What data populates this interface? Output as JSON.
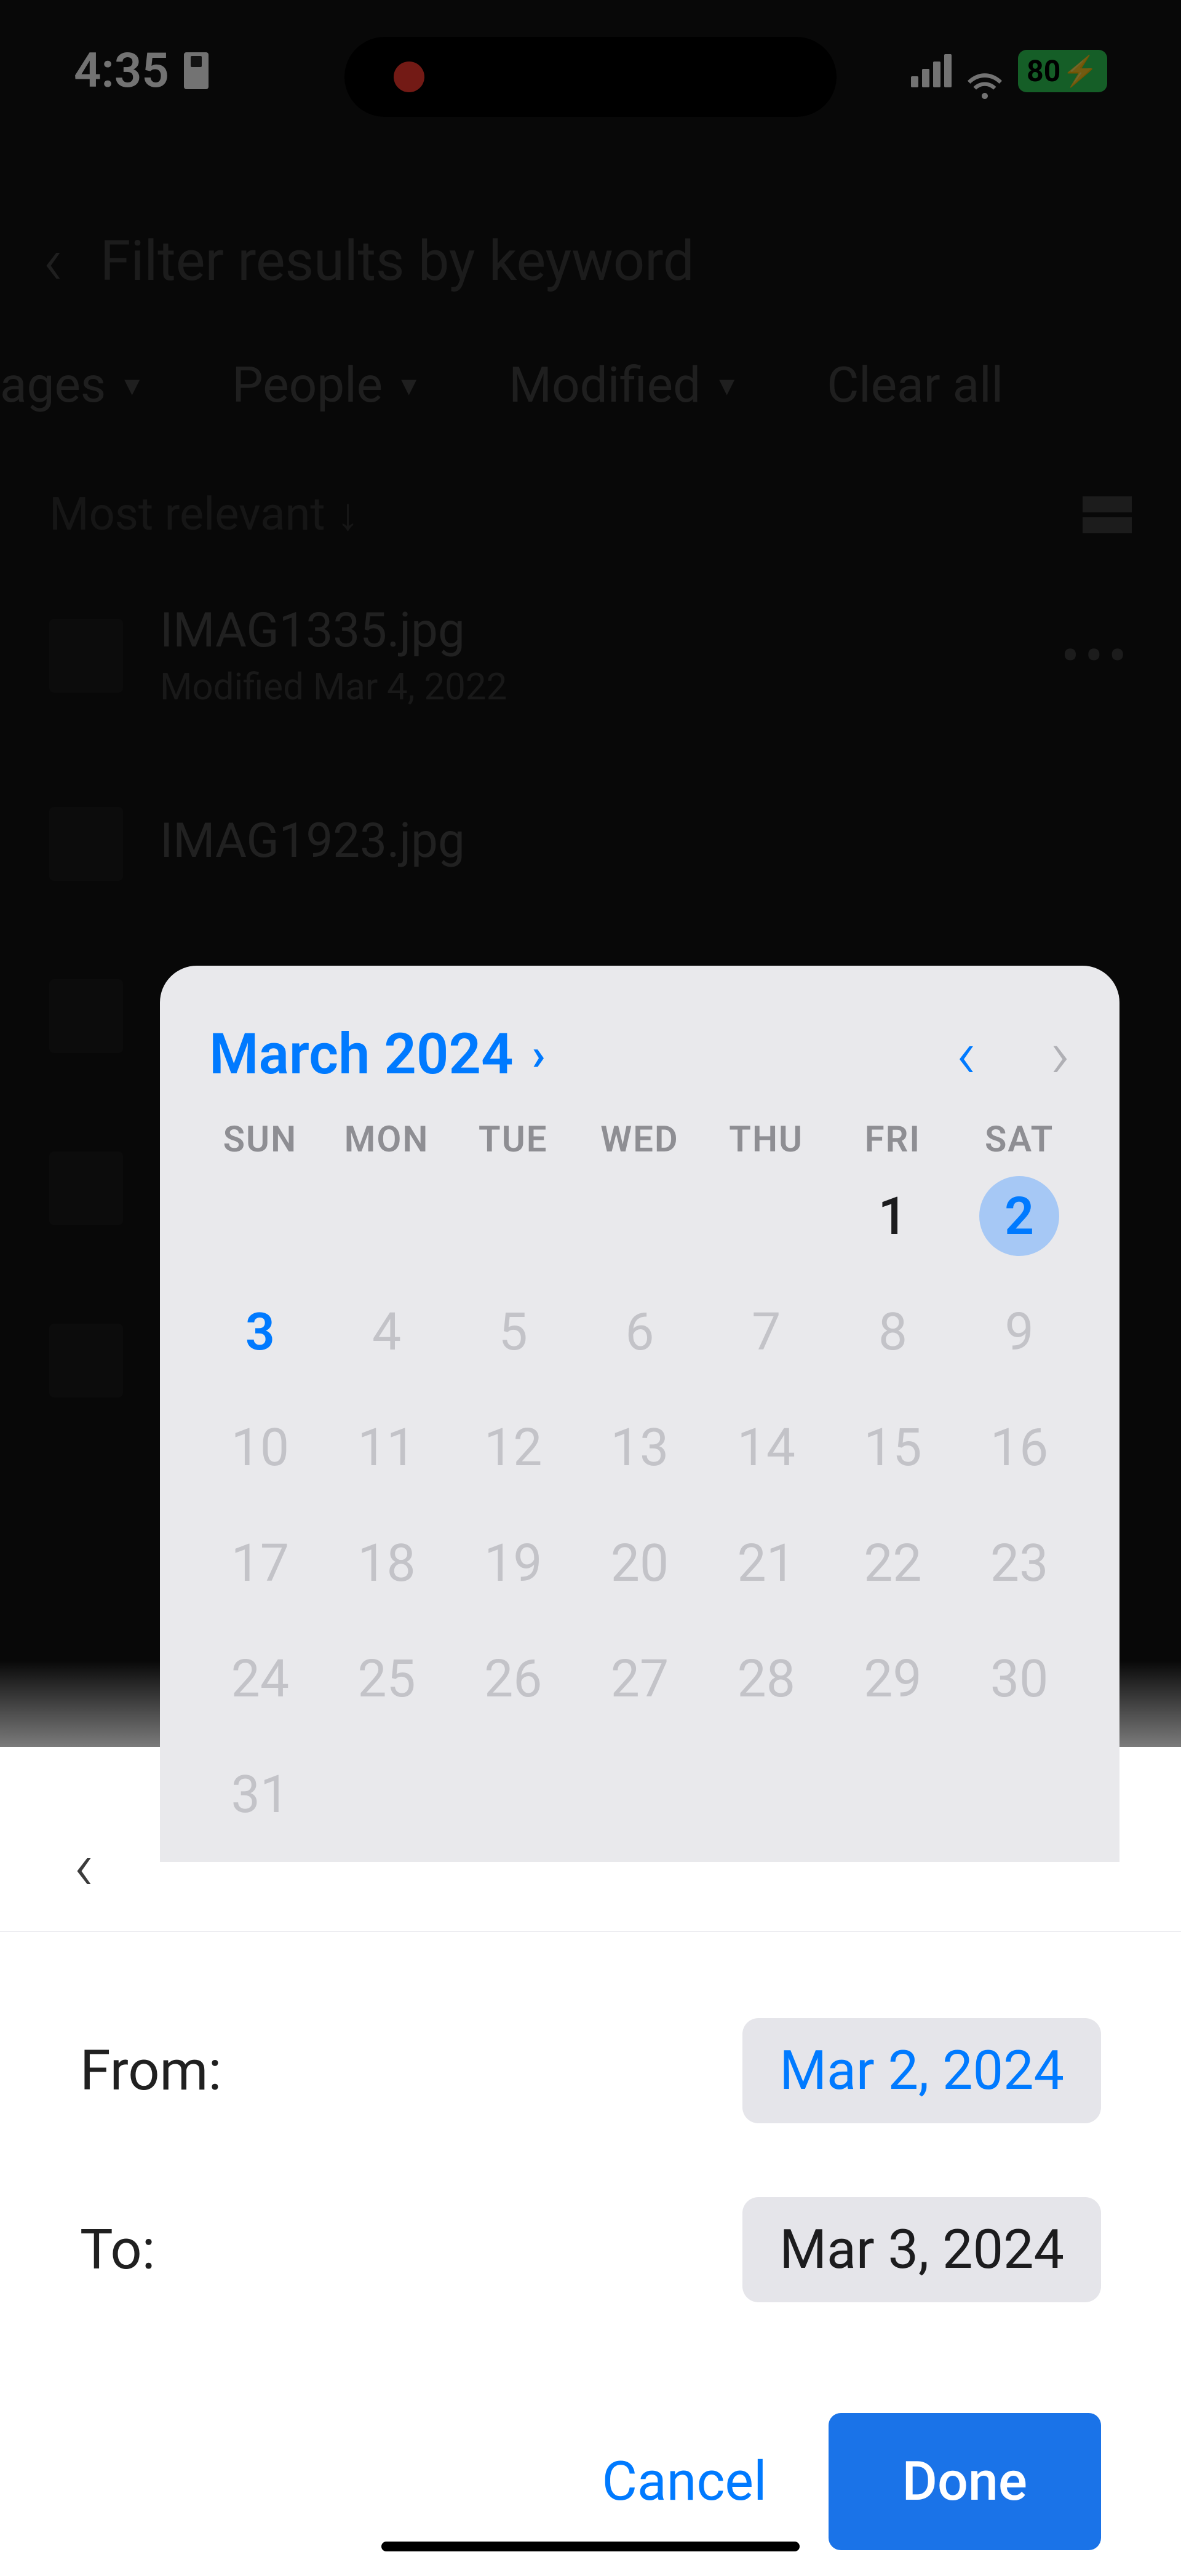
{
  "status": {
    "time": "4:35",
    "battery": "80"
  },
  "bg": {
    "search_placeholder": "Filter results by keyword",
    "filter_images": "ages",
    "filter_people": "People",
    "filter_modified": "Modified",
    "clear_all": "Clear all",
    "sort": "Most relevant",
    "items": [
      {
        "title": "IMAG1335.jpg",
        "sub": "Modified Mar 4, 2022"
      },
      {
        "title": "IMAG1923.jpg",
        "sub": ""
      }
    ]
  },
  "calendar": {
    "title": "March 2024",
    "weekdays": [
      "SUN",
      "MON",
      "TUE",
      "WED",
      "THU",
      "FRI",
      "SAT"
    ],
    "weeks": [
      [
        "",
        "",
        "",
        "",
        "",
        "1",
        "2"
      ],
      [
        "3",
        "4",
        "5",
        "6",
        "7",
        "8",
        "9"
      ],
      [
        "10",
        "11",
        "12",
        "13",
        "14",
        "15",
        "16"
      ],
      [
        "17",
        "18",
        "19",
        "20",
        "21",
        "22",
        "23"
      ],
      [
        "24",
        "25",
        "26",
        "27",
        "28",
        "29",
        "30"
      ],
      [
        "31",
        "",
        "",
        "",
        "",
        "",
        ""
      ]
    ],
    "today_day": "3",
    "selected_day": "2",
    "strong_days": [
      "1"
    ]
  },
  "range": {
    "from_label": "From:",
    "to_label": "To:",
    "from_value": "Mar 2, 2024",
    "to_value": "Mar 3, 2024"
  },
  "actions": {
    "cancel": "Cancel",
    "done": "Done"
  }
}
